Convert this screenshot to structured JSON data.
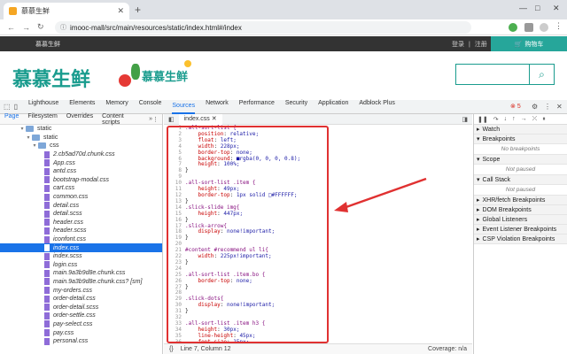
{
  "browser": {
    "tab_title": "慕慕生鲜",
    "url": "imooc-mall/src/main/resources/static/index.html#/index"
  },
  "site": {
    "brand_small": "慕慕生鲜",
    "login": "登录",
    "divider": "|",
    "register": "注册",
    "cart": "购物车",
    "logo_text": "慕慕生鲜",
    "logo_text2": "慕慕生鲜"
  },
  "devtools": {
    "tabs": [
      "Lighthouse",
      "Elements",
      "Memory",
      "Console",
      "Sources",
      "Network",
      "Performance",
      "Security",
      "Application",
      "Adblock Plus"
    ],
    "active_tab": "Sources",
    "error_count": "5",
    "nav_tabs": [
      "Page",
      "Filesystem",
      "Overrides",
      "Content scripts"
    ],
    "editor_file": "index.css",
    "status_pos": "Line 7, Column 12",
    "coverage": "Coverage: n/a"
  },
  "tree": [
    {
      "label": "static",
      "type": "folder",
      "indent": 3
    },
    {
      "label": "static",
      "type": "folder",
      "indent": 4
    },
    {
      "label": "css",
      "type": "folder",
      "indent": 5
    },
    {
      "label": "2.cb5ad70d.chunk.css",
      "type": "file",
      "indent": 6
    },
    {
      "label": "App.css",
      "type": "file",
      "indent": 6
    },
    {
      "label": "antd.css",
      "type": "file",
      "indent": 6
    },
    {
      "label": "bootstrap-modal.css",
      "type": "file",
      "indent": 6
    },
    {
      "label": "cart.css",
      "type": "file",
      "indent": 6
    },
    {
      "label": "common.css",
      "type": "file",
      "indent": 6
    },
    {
      "label": "detail.css",
      "type": "file",
      "indent": 6
    },
    {
      "label": "detail.scss",
      "type": "file",
      "indent": 6
    },
    {
      "label": "header.css",
      "type": "file",
      "indent": 6
    },
    {
      "label": "header.scss",
      "type": "file",
      "indent": 6
    },
    {
      "label": "iconfont.css",
      "type": "file",
      "indent": 6
    },
    {
      "label": "index.css",
      "type": "file",
      "indent": 6,
      "selected": true
    },
    {
      "label": "index.scss",
      "type": "file",
      "indent": 6
    },
    {
      "label": "login.css",
      "type": "file",
      "indent": 6
    },
    {
      "label": "main.9a3b9d8e.chunk.css",
      "type": "file",
      "indent": 6
    },
    {
      "label": "main.9a3b9d8e.chunk.css? [sm]",
      "type": "file",
      "indent": 6
    },
    {
      "label": "my-orders.css",
      "type": "file",
      "indent": 6
    },
    {
      "label": "order-detail.css",
      "type": "file",
      "indent": 6
    },
    {
      "label": "order-detail.scss",
      "type": "file",
      "indent": 6
    },
    {
      "label": "order-settle.css",
      "type": "file",
      "indent": 6
    },
    {
      "label": "pay-select.css",
      "type": "file",
      "indent": 6
    },
    {
      "label": "pay.css",
      "type": "file",
      "indent": 6
    },
    {
      "label": "personal.css",
      "type": "file",
      "indent": 6
    }
  ],
  "code": [
    ".all-sort-list {",
    "    position: relative;",
    "    float: left;",
    "    width: 228px;",
    "    border-top: none;",
    "    background: ■rgba(0, 0, 0, 0.8);",
    "    height: 100%;",
    "}",
    "",
    ".all-sort-list .item {",
    "    height: 49px;",
    "    border-top: 1px solid □#FFFFFF;",
    "}",
    ".slick-slide img{",
    "    height: 447px;",
    "}",
    ".slick-arrow{",
    "    display: none!important;",
    "}",
    "",
    "#content #recommend ul li{",
    "    width: 225px!important;",
    "}",
    "",
    ".all-sort-list .item.bo {",
    "    border-top: none;",
    "}",
    "",
    ".slick-dots{",
    "    display: none!important;",
    "}",
    "",
    ".all-sort-list .item h3 {",
    "    height: 30px;",
    "    line-height: 45px;",
    "    font-size: 15px;",
    "    font-weight: normal;"
  ],
  "debugger": {
    "sections": [
      {
        "label": "Watch",
        "note": ""
      },
      {
        "label": "Breakpoints",
        "note": "No breakpoints"
      },
      {
        "label": "Scope",
        "note": "Not paused"
      },
      {
        "label": "Call Stack",
        "note": "Not paused"
      },
      {
        "label": "XHR/fetch Breakpoints",
        "note": ""
      },
      {
        "label": "DOM Breakpoints",
        "note": ""
      },
      {
        "label": "Global Listeners",
        "note": ""
      },
      {
        "label": "Event Listener Breakpoints",
        "note": ""
      },
      {
        "label": "CSP Violation Breakpoints",
        "note": ""
      }
    ]
  }
}
